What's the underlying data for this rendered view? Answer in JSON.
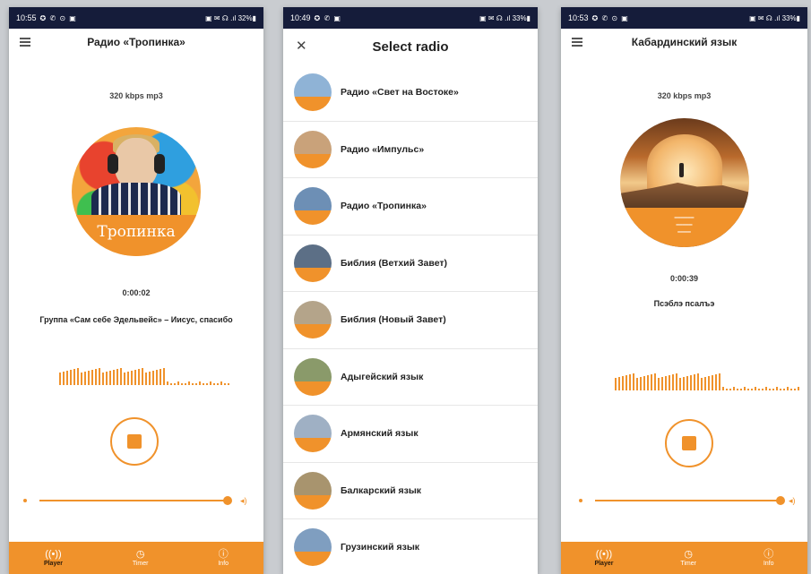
{
  "colors": {
    "accent": "#f0922b",
    "statusbar": "#151c3a"
  },
  "screens": [
    {
      "status": {
        "time": "10:55",
        "icons": "✪ ✆ ⊙ ▣",
        "right": "▣ ✉ ☊ .ıl 32%▮"
      },
      "title": "Радио «Тропинка»",
      "bitrate": "320 kbps mp3",
      "cover_text": "Тропинка",
      "time": "0:00:02",
      "track": "Группа «Сам себе Эдельвейс» – Иисус, спасибо",
      "volume_level": 0.92
    },
    {
      "status": {
        "time": "10:49",
        "icons": "✪ ✆ ▣",
        "right": "▣ ✉ ☊ .ıl 33%▮"
      },
      "title": "Select radio",
      "items": [
        "Радио «Свет на Востоке»",
        "Радио «Импульс»",
        "Радио «Тропинка»",
        "Библия (Ветхий Завет)",
        "Библия (Новый Завет)",
        "Адыгейский язык",
        "Армянский язык",
        "Балкарский язык",
        "Грузинский язык"
      ]
    },
    {
      "status": {
        "time": "10:53",
        "icons": "✪ ✆ ⊙ ▣",
        "right": "▣ ✉ ☊ .ıl 33%▮"
      },
      "title": "Кабардинский язык",
      "bitrate": "320 kbps mp3",
      "time": "0:00:39",
      "track": "Псэблэ псалъэ",
      "volume_level": 0.94
    }
  ],
  "nav": {
    "player": "Player",
    "timer": "Timer",
    "info": "Info",
    "player_icon": "radio-waves-icon",
    "timer_icon": "clock-icon",
    "info_icon": "info-icon"
  }
}
